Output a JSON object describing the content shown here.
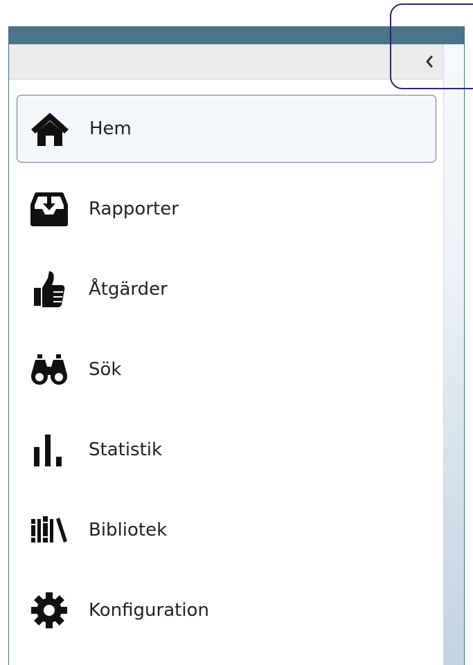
{
  "header": {
    "collapse_icon": "chevron-left-icon"
  },
  "nav": {
    "items": [
      {
        "label": "Hem",
        "icon": "home-icon",
        "active": true
      },
      {
        "label": "Rapporter",
        "icon": "inbox-download-icon",
        "active": false
      },
      {
        "label": "Åtgärder",
        "icon": "thumbs-up-icon",
        "active": false
      },
      {
        "label": "Sök",
        "icon": "binoculars-icon",
        "active": false
      },
      {
        "label": "Statistik",
        "icon": "bar-chart-icon",
        "active": false
      },
      {
        "label": "Bibliotek",
        "icon": "books-icon",
        "active": false
      },
      {
        "label": "Konfiguration",
        "icon": "gear-icon",
        "active": false
      }
    ]
  },
  "colors": {
    "top_bar": "#4a7489",
    "header_bg": "#ebebeb",
    "active_item_bg": "#f3f7fa",
    "active_item_border": "#6f7d87",
    "highlight_outline": "#2b2380",
    "text": "#222222"
  }
}
